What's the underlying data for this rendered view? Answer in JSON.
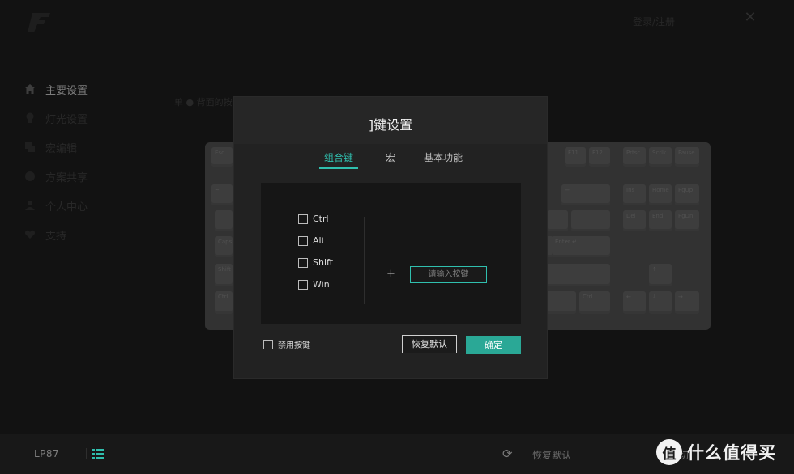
{
  "app": {
    "login_text": "登录/注册",
    "sidebar": [
      {
        "label": "主要设置",
        "icon": "home-icon",
        "active": true
      },
      {
        "label": "灯光设置",
        "icon": "bulb-icon",
        "active": false
      },
      {
        "label": "宏编辑",
        "icon": "macro-icon",
        "active": false
      },
      {
        "label": "方案共享",
        "icon": "share-icon",
        "active": false
      },
      {
        "label": "个人中心",
        "icon": "user-icon",
        "active": false
      },
      {
        "label": "支持",
        "icon": "heart-icon",
        "active": false
      }
    ],
    "hint_text": "单 ● 背面的按键",
    "bottom": {
      "model": "LP87",
      "restore_label": "恢复默认",
      "cut_label": "切"
    }
  },
  "modal": {
    "title": "]键设置",
    "tabs": [
      {
        "label": "组合键",
        "active": true
      },
      {
        "label": "宏",
        "active": false
      },
      {
        "label": "基本功能",
        "active": false
      }
    ],
    "modifiers": [
      "Ctrl",
      "Alt",
      "Shift",
      "Win"
    ],
    "plus": "+",
    "key_input_placeholder": "请输入按键",
    "disable_label": "禁用按键",
    "restore_button": "恢复默认",
    "confirm_button": "确定"
  },
  "keyboard": {
    "visible_keys": [
      "Esc",
      "F11",
      "F12",
      "Prtsc",
      "Scrlk",
      "Pause",
      "~",
      "←",
      "Ins",
      "Home",
      "PgUp",
      "Del",
      "End",
      "PgDn",
      "Caps",
      "Enter ↵",
      "Shift",
      "↑",
      "Ctrl",
      "Ctrl",
      "←",
      "↓",
      "→"
    ]
  },
  "watermark": {
    "circle": "值",
    "text": "什么值得买"
  },
  "colors": {
    "accent": "#30bfae",
    "confirm_bg": "#2aa896",
    "background": "#1b1b1b",
    "modal_bg": "#222222"
  }
}
